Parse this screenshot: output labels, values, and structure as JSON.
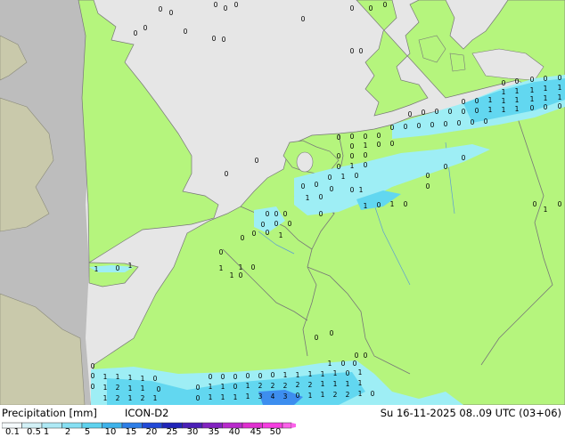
{
  "map": {
    "title": "Precipitation [mm]",
    "model": "ICON-D2",
    "valid_time": "Su 16-11-2025 08..09 UTC (03+06)",
    "colors": {
      "sea": "#e6e6e6",
      "land_in_domain": "#b5f57d",
      "land_outside": "#bdbdbd",
      "land_uk_wales": "#c8c8a8",
      "border": "#777777",
      "precip_light": "#9eeef5",
      "precip_medium": "#62d7f0",
      "precip_heavy": "#3d8eef"
    },
    "point_values": [
      "0",
      "1",
      "2",
      "3",
      "4"
    ]
  },
  "legend": {
    "labels": [
      "0.1",
      "0.5",
      "1",
      "2",
      "5",
      "10",
      "15",
      "20",
      "25",
      "30",
      "35",
      "40",
      "45",
      "50"
    ],
    "colors": [
      "#f5fafc",
      "#d2f1f7",
      "#aee9f5",
      "#86dff3",
      "#5ed2ee",
      "#3eb2ea",
      "#2c7de6",
      "#2149d6",
      "#2024b8",
      "#4a1fb6",
      "#8222c0",
      "#b82acb",
      "#df2fcf",
      "#f53ee0",
      "#fb62ea"
    ]
  }
}
